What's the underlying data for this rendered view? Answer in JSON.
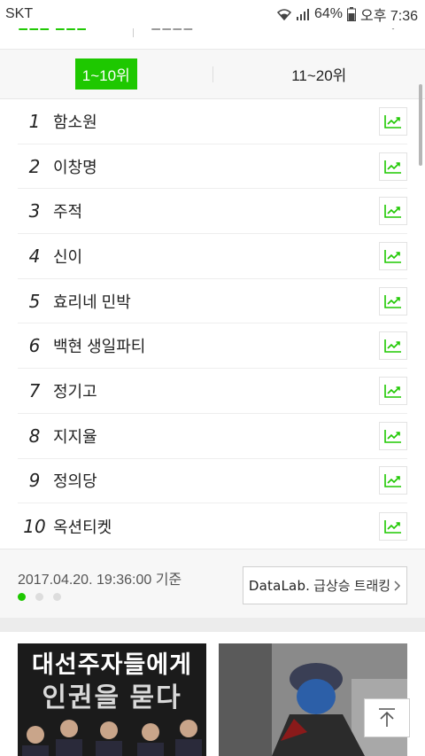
{
  "status_bar": {
    "carrier": "SKT",
    "battery": "64%",
    "time": "오후 7:36"
  },
  "tabs": [
    {
      "label": "1~10위",
      "active": true
    },
    {
      "label": "11~20위",
      "active": false
    }
  ],
  "ranking": [
    {
      "rank": "1",
      "keyword": "함소원"
    },
    {
      "rank": "2",
      "keyword": "이창명"
    },
    {
      "rank": "3",
      "keyword": "주적"
    },
    {
      "rank": "4",
      "keyword": "신이"
    },
    {
      "rank": "5",
      "keyword": "효리네 민박"
    },
    {
      "rank": "6",
      "keyword": "백현 생일파티"
    },
    {
      "rank": "7",
      "keyword": "정기고"
    },
    {
      "rank": "8",
      "keyword": "지지율"
    },
    {
      "rank": "9",
      "keyword": "정의당"
    },
    {
      "rank": "10",
      "keyword": "옥션티켓"
    }
  ],
  "footer": {
    "timestamp": "2017.04.20. 19:36:00 기준",
    "datalab_brand": "DataLab.",
    "datalab_label": "급상승 트래킹",
    "page_dots": 3,
    "active_dot": 0
  },
  "cards": [
    {
      "line1": "대선주자들에게",
      "line2": "인권을 묻다"
    },
    {
      "line1": "",
      "line2": ""
    }
  ],
  "colors": {
    "accent": "#1ec800",
    "trend_icon": "#1ec800"
  }
}
